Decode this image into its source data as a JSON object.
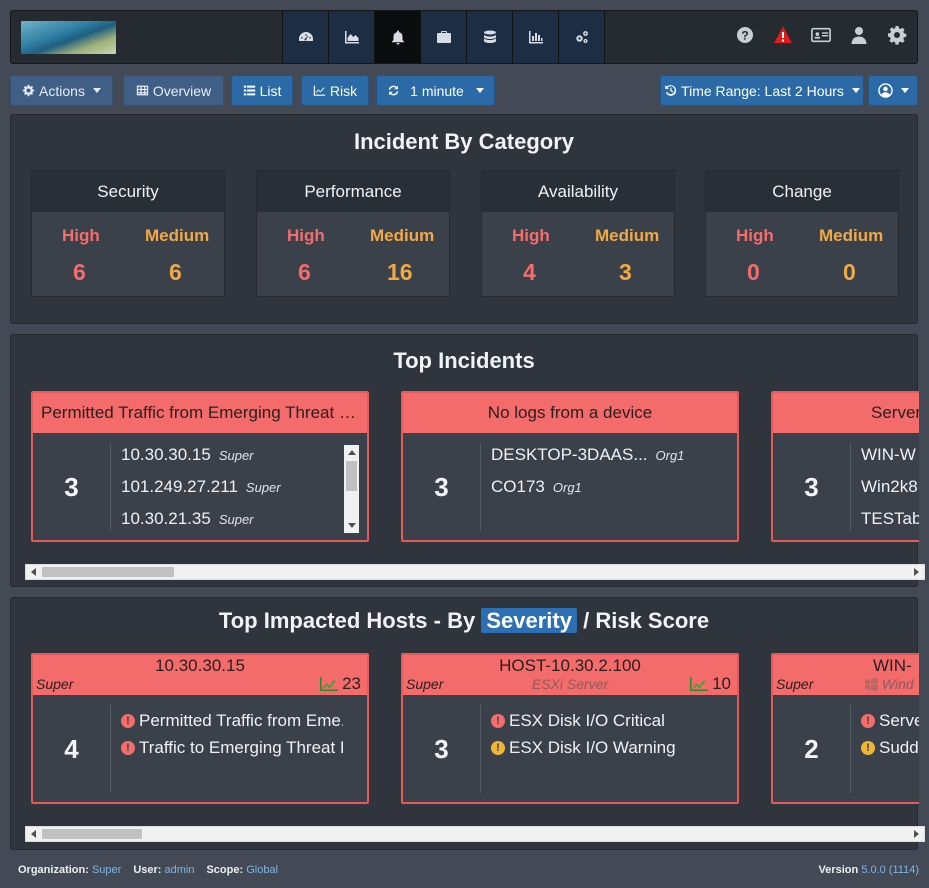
{
  "nav": {
    "tabs": [
      "dashboard",
      "analytics",
      "incidents",
      "cmdb",
      "resources",
      "reports",
      "admin"
    ],
    "active": "incidents"
  },
  "toolbar": {
    "actions": "Actions",
    "overview": "Overview",
    "list": "List",
    "risk": "Risk",
    "refresh": "1 minute",
    "time_range": "Time Range: Last 2 Hours"
  },
  "category": {
    "title": "Incident By Category",
    "high_label": "High",
    "medium_label": "Medium",
    "cards": [
      {
        "name": "Security",
        "high": "6",
        "medium": "6"
      },
      {
        "name": "Performance",
        "high": "6",
        "medium": "16"
      },
      {
        "name": "Availability",
        "high": "4",
        "medium": "3"
      },
      {
        "name": "Change",
        "high": "0",
        "medium": "0"
      }
    ]
  },
  "top_incidents": {
    "title": "Top Incidents",
    "cards": [
      {
        "title": "Permitted Traffic from Emerging Threat IP ...",
        "count": "3",
        "rows": [
          {
            "host": "10.30.30.15",
            "org": "Super"
          },
          {
            "host": "101.249.27.211",
            "org": "Super"
          },
          {
            "host": "10.30.21.35",
            "org": "Super"
          }
        ]
      },
      {
        "title": "No logs from a device",
        "count": "3",
        "rows": [
          {
            "host": "DESKTOP-3DAAS...",
            "org": "Org1"
          },
          {
            "host": "CO173",
            "org": "Org1"
          }
        ]
      },
      {
        "title": "Server",
        "count": "3",
        "rows": [
          {
            "host": "WIN-W",
            "org": ""
          },
          {
            "host": "Win2k8",
            "org": ""
          },
          {
            "host": "TESTab",
            "org": ""
          }
        ]
      }
    ]
  },
  "impacted": {
    "title_prefix": "Top Impacted Hosts - By",
    "severity": "Severity",
    "sep": "/",
    "risk_score": "Risk Score",
    "cards": [
      {
        "host": "10.30.30.15",
        "org": "Super",
        "type": "",
        "risk": "23",
        "count": "4",
        "rows": [
          {
            "text": "Permitted Traffic from Eme...",
            "sev": "r"
          },
          {
            "text": "Traffic to Emerging Threat I...",
            "sev": "r"
          }
        ]
      },
      {
        "host": "HOST-10.30.2.100",
        "org": "Super",
        "type": "ESXi Server",
        "risk": "10",
        "count": "3",
        "rows": [
          {
            "text": "ESX Disk I/O Critical",
            "sev": "r"
          },
          {
            "text": "ESX Disk I/O Warning",
            "sev": "o"
          }
        ]
      },
      {
        "host": "WIN-",
        "org": "Super",
        "type": "Wind",
        "risk": "",
        "count": "2",
        "rows": [
          {
            "text": "Serve",
            "sev": "r"
          },
          {
            "text": "Sudd",
            "sev": "o"
          }
        ]
      }
    ]
  },
  "footer": {
    "org_label": "Organization:",
    "org": "Super",
    "user_label": "User:",
    "user": "admin",
    "scope_label": "Scope:",
    "scope": "Global",
    "version_label": "Version",
    "version": "5.0.0 (1114)"
  }
}
